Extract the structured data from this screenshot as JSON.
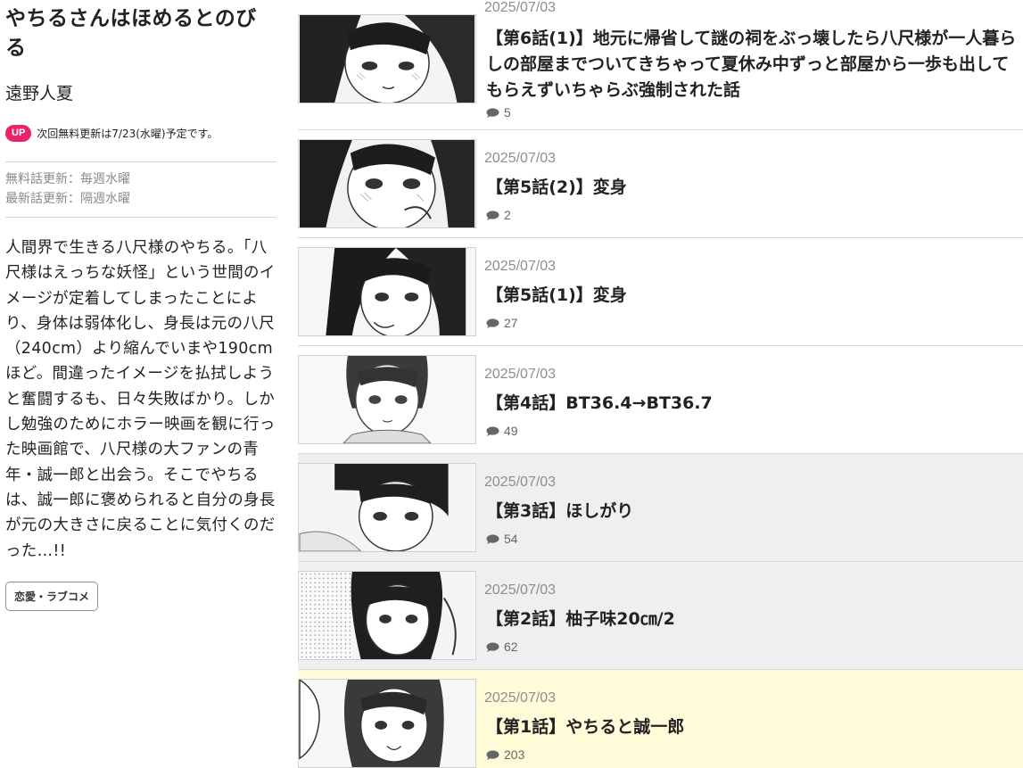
{
  "series": {
    "title": "やちるさんはほめるとのびる",
    "author": "遠野人夏",
    "up_badge": "UP",
    "next_update": "次回無料更新は7/23(水曜)予定です。",
    "schedule_free": "無料話更新：毎週水曜",
    "schedule_latest": "最新話更新：隔週水曜",
    "description": "人間界で生きる八尺様のやちる。「八尺様はえっちな妖怪」という世間のイメージが定着してしまったことにより、身体は弱体化し、身長は元の八尺（240cm）より縮んでいまや190cmほど。間違ったイメージを払拭しようと奮闘するも、日々失敗ばかり。しかし勉強のためにホラー映画を観に行った映画館で、八尺様の大ファンの青年・誠一郎と出会う。そこでやちるは、誠一郎に褒められると自分の身長が元の大きさに戻ることに気付くのだった…!!",
    "genre_tag": "恋愛・ラブコメ"
  },
  "episodes": [
    {
      "date": "2025/07/03",
      "title": "【第6話(1)】地元に帰省して謎の祠をぶっ壊したら八尺様が一人暮らしの部屋までついてきちゃって夏休み中ずっと部屋から一歩も出してもらえずいちゃらぶ強制された話",
      "comments": "5",
      "state": "normal",
      "icon": "manga-thumbnail"
    },
    {
      "date": "2025/07/03",
      "title": "【第5話(2)】変身",
      "comments": "2",
      "state": "normal",
      "icon": "manga-thumbnail"
    },
    {
      "date": "2025/07/03",
      "title": "【第5話(1)】変身",
      "comments": "27",
      "state": "normal",
      "icon": "manga-thumbnail"
    },
    {
      "date": "2025/07/03",
      "title": "【第4話】BT36.4→BT36.7",
      "comments": "49",
      "state": "normal",
      "icon": "manga-thumbnail"
    },
    {
      "date": "2025/07/03",
      "title": "【第3話】ほしがり",
      "comments": "54",
      "state": "read",
      "icon": "manga-thumbnail"
    },
    {
      "date": "2025/07/03",
      "title": "【第2話】柚子味20㎝/2",
      "comments": "62",
      "state": "read",
      "icon": "manga-thumbnail"
    },
    {
      "date": "2025/07/03",
      "title": "【第1話】やちると誠一郎",
      "comments": "203",
      "state": "current",
      "icon": "manga-thumbnail"
    }
  ],
  "colors": {
    "up_badge": "#e8256a",
    "read_background": "#efefef",
    "current_background": "#fffbd9",
    "date_text": "#8e8e8e"
  },
  "icons": {
    "comment": "speech-bubble-icon"
  }
}
